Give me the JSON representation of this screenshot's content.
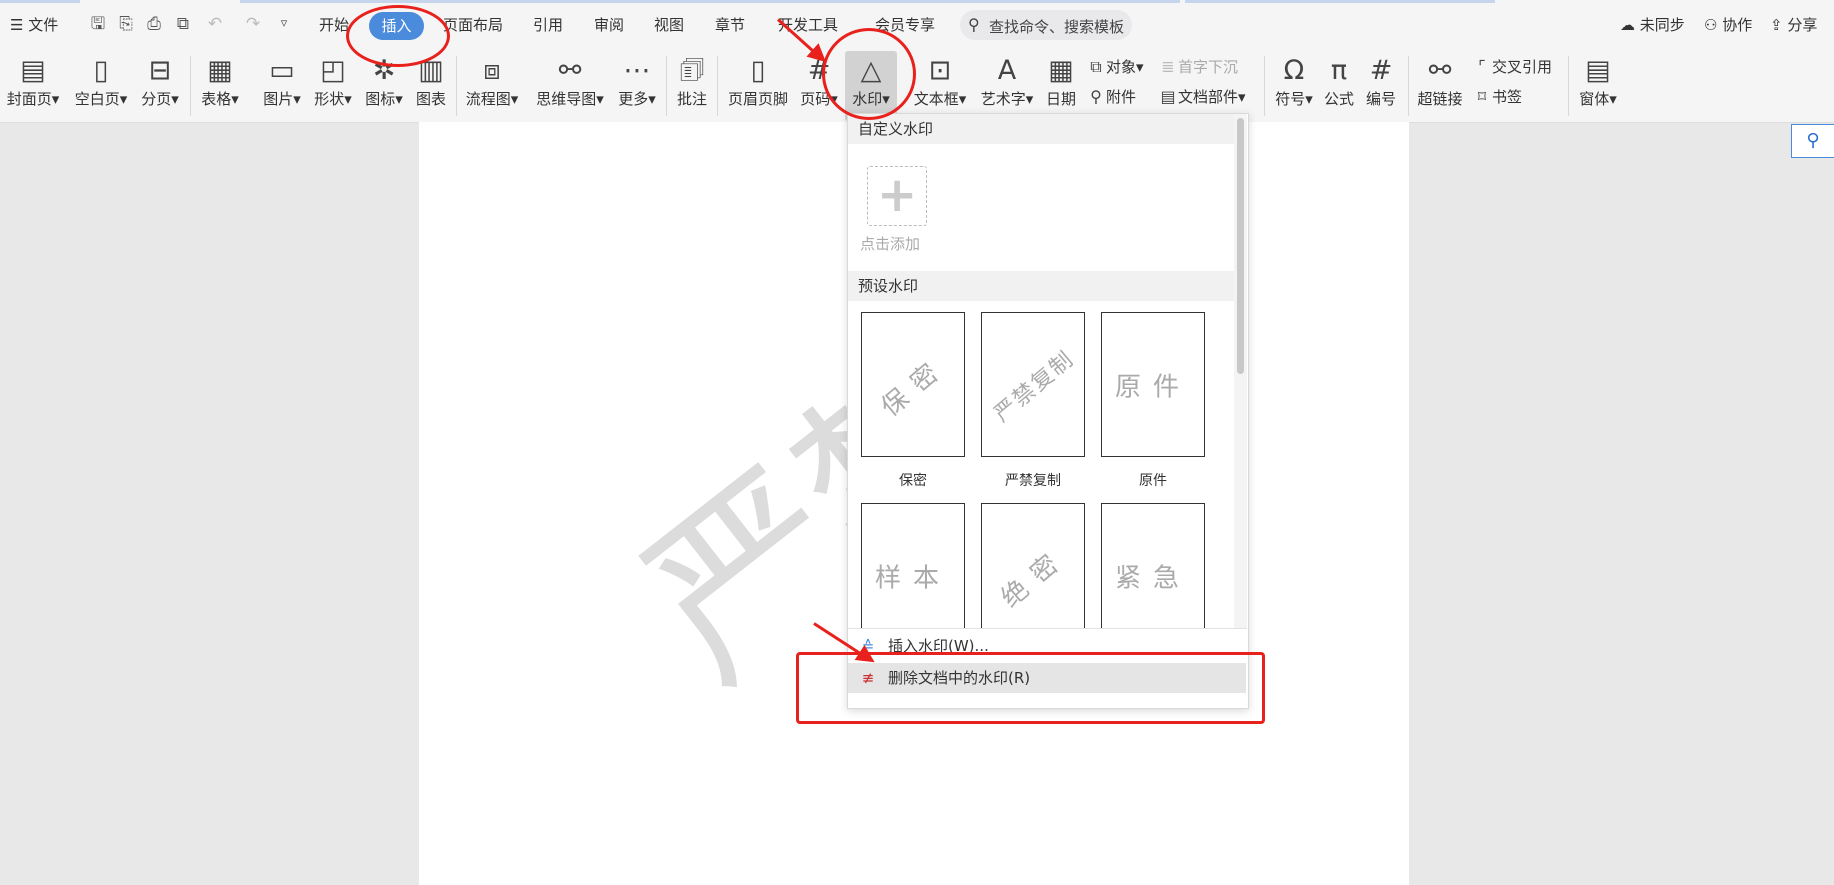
{
  "menubar": {
    "file_label": "文件",
    "tabs": [
      "开始",
      "插入",
      "页面布局",
      "引用",
      "审阅",
      "视图",
      "章节",
      "开发工具",
      "会员专享"
    ],
    "search_placeholder": "查找命令、搜索模板",
    "right": {
      "sync": "未同步",
      "collab": "协作",
      "share": "分享"
    }
  },
  "ribbon": {
    "cover": "封面页",
    "blank": "空白页",
    "pagebreak": "分页",
    "table": "表格",
    "picture": "图片",
    "shape": "形状",
    "icon": "图标",
    "chart": "图表",
    "flowchart": "流程图",
    "mindmap": "思维导图",
    "more": "更多",
    "comment": "批注",
    "header_footer": "页眉页脚",
    "page_number": "页码",
    "watermark": "水印",
    "textbox": "文本框",
    "wordart": "艺术字",
    "date": "日期",
    "object": "对象",
    "dropcap": "首字下沉",
    "attachment": "附件",
    "docparts": "文档部件",
    "symbol": "符号",
    "formula": "公式",
    "numbering": "编号",
    "hyperlink": "超链接",
    "crossref": "交叉引用",
    "bookmark": "书签",
    "window": "窗体"
  },
  "document": {
    "watermark_text": "严禁"
  },
  "dropdown": {
    "custom_header": "自定义水印",
    "add_label": "点击添加",
    "preset_header": "预设水印",
    "presets": [
      {
        "text": "保密",
        "caption": "保密"
      },
      {
        "text": "严禁复制",
        "caption": "严禁复制"
      },
      {
        "text": "原件",
        "caption": "原件"
      },
      {
        "text": "样本"
      },
      {
        "text": "绝密"
      },
      {
        "text": "紧急"
      }
    ],
    "insert_item": "插入水印(W)...",
    "remove_item": "删除文档中的水印(R)"
  },
  "colors": {
    "accent": "#4a8bdc",
    "annotation": "#e8211c"
  }
}
